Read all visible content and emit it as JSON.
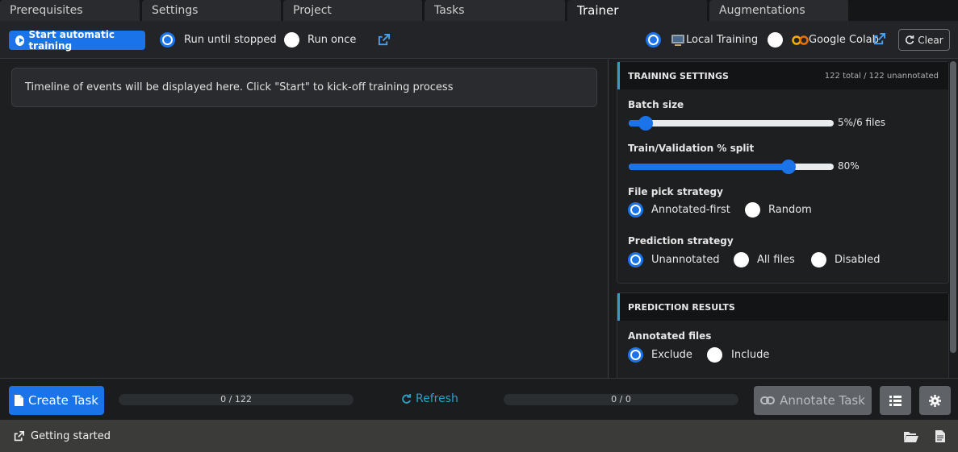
{
  "tabs": [
    {
      "label": "Prerequisites"
    },
    {
      "label": "Settings"
    },
    {
      "label": "Project"
    },
    {
      "label": "Tasks"
    },
    {
      "label": "Trainer"
    },
    {
      "label": "Augmentations"
    }
  ],
  "active_tab": "Trainer",
  "toolbar": {
    "start_label": "Start automatic training",
    "run_until_stopped": "Run until stopped",
    "run_once": "Run once",
    "local_training": "Local Training",
    "google_colab": "Google Colab",
    "clear_label": "Clear"
  },
  "timeline": {
    "message": "Timeline of events will be displayed here. Click \"Start\" to kick-off training process"
  },
  "training_settings": {
    "title": "TRAINING SETTINGS",
    "count": "122 total / 122 unannotated",
    "batch_size_label": "Batch size",
    "batch_size_value": "5%/6 files",
    "batch_size_fraction": 0.05,
    "split_label": "Train/Validation % split",
    "split_value": "80%",
    "split_fraction": 0.8,
    "file_pick_label": "File pick strategy",
    "file_pick_options": [
      "Annotated-first",
      "Random"
    ],
    "prediction_label": "Prediction strategy",
    "prediction_options": [
      "Unannotated",
      "All files",
      "Disabled"
    ]
  },
  "prediction_results": {
    "title": "PREDICTION RESULTS",
    "annotated_label": "Annotated files",
    "annotated_options": [
      "Exclude",
      "Include"
    ]
  },
  "bottom": {
    "create_task": "Create Task",
    "progress_left": "0 / 122",
    "refresh": "Refresh",
    "progress_right": "0 / 0",
    "annotate_task": "Annotate Task"
  },
  "status": {
    "getting_started": "Getting started"
  },
  "colors": {
    "accent": "#1a73e8",
    "teal": "#2aa3c4"
  }
}
